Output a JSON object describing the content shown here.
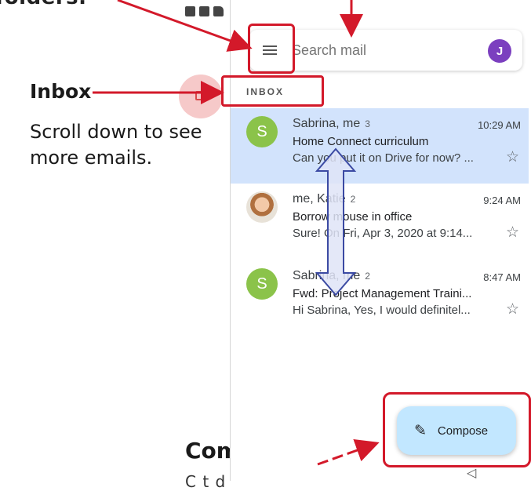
{
  "annotations": {
    "top_cut_text": "folders.",
    "inbox_label": "Inbox",
    "scroll_note": "Scroll down to see more emails.",
    "compose_label": "Compose",
    "bottom_cut_text": "C  t  d"
  },
  "gmail": {
    "search_placeholder": "Search mail",
    "account_initial": "J",
    "section_heading": "INBOX",
    "compose_button": "Compose",
    "icons": [
      "menu-icon",
      "account-avatar",
      "pencil-icon",
      "star-icon",
      "back-triangle-icon"
    ],
    "emails": [
      {
        "sender": "Sabrina, me",
        "count": "3",
        "time": "10:29 AM",
        "subject": "Home Connect curriculum",
        "snippet": "Can you put it on Drive for now? ...",
        "avatar_letter": "S",
        "avatar_color": "#8bc34a",
        "selected": true
      },
      {
        "sender": "me, Katie",
        "count": "2",
        "time": "9:24 AM",
        "subject": "Borrow mouse in office",
        "snippet": "Sure! On Fri, Apr 3, 2020 at 9:14...",
        "avatar_letter": "",
        "avatar_color": "",
        "selected": false
      },
      {
        "sender": "Sabrina, me",
        "count": "2",
        "time": "8:47 AM",
        "subject": "Fwd: Project Management Traini...",
        "snippet": "Hi Sabrina, Yes, I would definitel...",
        "avatar_letter": "S",
        "avatar_color": "#8bc34a",
        "selected": false
      }
    ]
  },
  "colors": {
    "highlight": "#d3192a",
    "selected_row": "#d2e3fc",
    "compose_bg": "#c2e7ff",
    "arrow_fill": "#dfe4f7"
  }
}
